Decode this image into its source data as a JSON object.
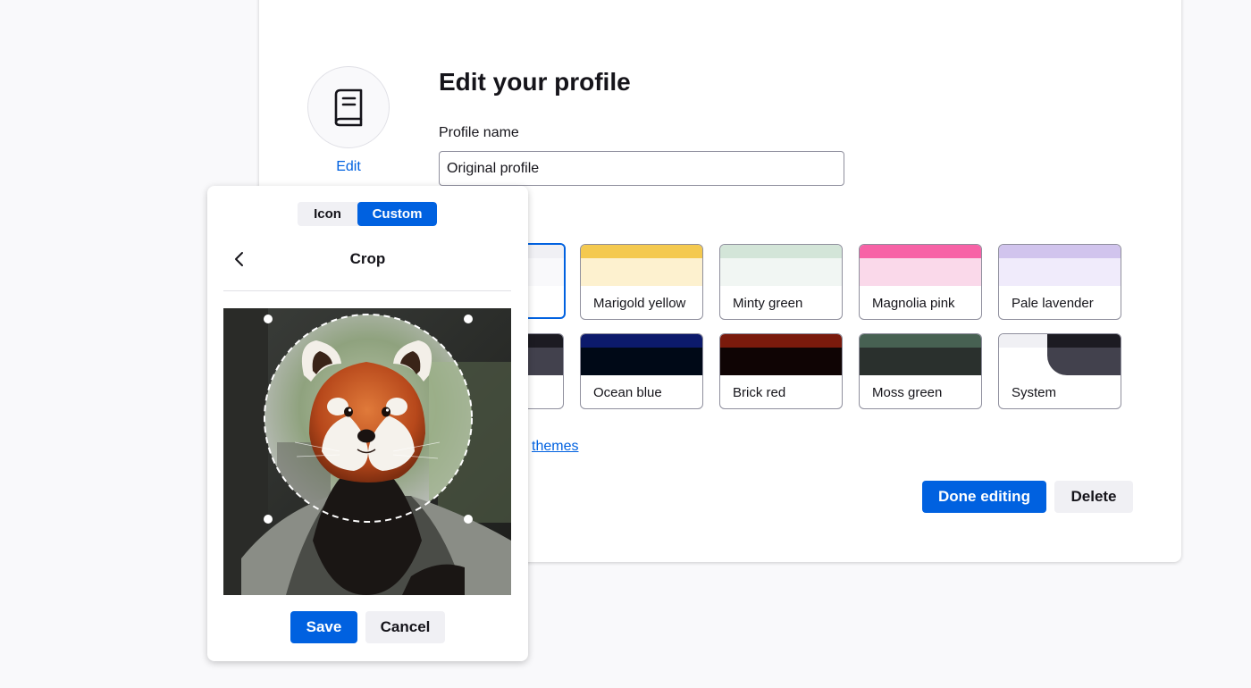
{
  "profile": {
    "title": "Edit your profile",
    "edit_link": "Edit",
    "name_label": "Profile name",
    "name_value": "Original profile",
    "avatar_icon": "book-icon",
    "more_themes_link": "themes"
  },
  "themes": [
    {
      "label": "",
      "selected": true,
      "top": "#f0f0f4",
      "mid": "#f9f9fb"
    },
    {
      "label": "Marigold yellow",
      "top": "#f4c94f",
      "mid": "#fdf1cf"
    },
    {
      "label": "Minty green",
      "top": "#d3e5d8",
      "mid": "#f1f6f3"
    },
    {
      "label": "Magnolia pink",
      "top": "#f762a6",
      "mid": "#fad9ea"
    },
    {
      "label": "Pale lavender",
      "top": "#d1c4ed",
      "mid": "#f0ebfb"
    },
    {
      "label": "",
      "top": "#1c1b22",
      "mid": "#42414d"
    },
    {
      "label": "Ocean blue",
      "top": "#0c1a6b",
      "mid": "#000917"
    },
    {
      "label": "Brick red",
      "top": "#7a1a0c",
      "mid": "#0f0404"
    },
    {
      "label": "Moss green",
      "top": "#476152",
      "mid": "#2a302d"
    },
    {
      "label": "System",
      "top": "#f0f0f4",
      "mid": "#ffffff"
    }
  ],
  "actions": {
    "done_label": "Done editing",
    "delete_label": "Delete"
  },
  "popup": {
    "tab_icon": "Icon",
    "tab_custom": "Custom",
    "active_tab": "Custom",
    "crop_title": "Crop",
    "save_label": "Save",
    "cancel_label": "Cancel"
  },
  "colors": {
    "accent": "#0061e0",
    "background": "#f9f9fb",
    "text": "#15141a",
    "border": "#8f8f9d"
  }
}
